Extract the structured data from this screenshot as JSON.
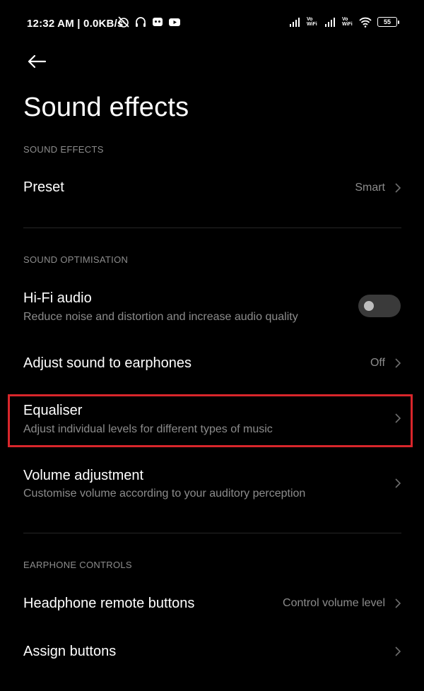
{
  "status_bar": {
    "time": "12:32 AM",
    "network_speed": "0.0KB/s",
    "vowifi_1": "Vo\nWiFi",
    "vowifi_2": "Vo\nWiFi",
    "battery": "55"
  },
  "header": {
    "title": "Sound effects"
  },
  "sections": {
    "sound_effects": {
      "header": "SOUND EFFECTS",
      "preset": {
        "title": "Preset",
        "value": "Smart"
      }
    },
    "sound_optimisation": {
      "header": "SOUND OPTIMISATION",
      "hifi": {
        "title": "Hi-Fi audio",
        "subtitle": "Reduce noise and distortion and increase audio quality",
        "enabled": false
      },
      "adjust_earphones": {
        "title": "Adjust sound to earphones",
        "value": "Off"
      },
      "equaliser": {
        "title": "Equaliser",
        "subtitle": "Adjust individual levels for different types of music"
      },
      "volume_adjustment": {
        "title": "Volume adjustment",
        "subtitle": "Customise volume according to your auditory perception"
      }
    },
    "earphone_controls": {
      "header": "EARPHONE CONTROLS",
      "remote_buttons": {
        "title": "Headphone remote buttons",
        "value": "Control volume level"
      },
      "assign_buttons": {
        "title": "Assign buttons"
      }
    }
  },
  "colors": {
    "background": "#000000",
    "secondary_text": "#8c8c8c",
    "highlight": "#d9262b"
  }
}
